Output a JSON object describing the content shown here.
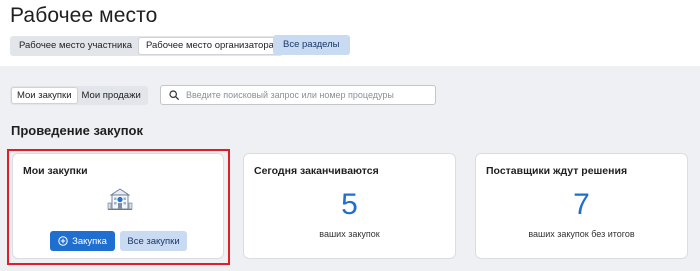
{
  "page": {
    "title": "Рабочее место"
  },
  "workspace_switch": {
    "items": [
      "Рабочее место участника",
      "Рабочее место организатора"
    ],
    "active_index": 1
  },
  "all_sections_button": {
    "label": "Все разделы"
  },
  "tabs": {
    "items": [
      "Мои закупки",
      "Мои продажи"
    ],
    "active_index": 0
  },
  "search": {
    "placeholder": "Введите поисковый запрос или номер процедуры",
    "value": "",
    "icon": "search-icon"
  },
  "section": {
    "title": "Проведение закупок"
  },
  "cards": {
    "my_purchases": {
      "title": "Мои закупки",
      "illustration": "building-icon",
      "primary_button": {
        "label": "Закупка",
        "icon": "plus-circle-icon"
      },
      "secondary_button": {
        "label": "Все закупки"
      }
    },
    "ending_today": {
      "title": "Сегодня заканчиваются",
      "value": "5",
      "caption": "ваших закупок"
    },
    "awaiting_decision": {
      "title": "Поставщики ждут решения",
      "value": "7",
      "caption": "ваших закупок без итогов"
    }
  },
  "colors": {
    "accent": "#1f6fd1",
    "light_accent": "#c9daf3",
    "highlight": "#e01e2a",
    "background": "#eef0f3"
  }
}
